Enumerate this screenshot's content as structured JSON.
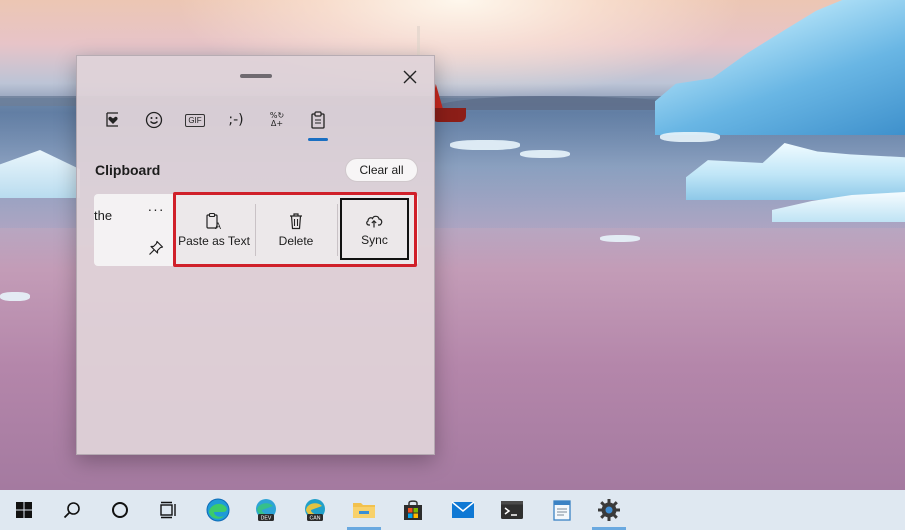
{
  "clipboard_panel": {
    "tabs": [
      {
        "name": "favorites",
        "icon": "heart-in-box-icon"
      },
      {
        "name": "emoji",
        "icon": "smiley-icon"
      },
      {
        "name": "gif",
        "icon": "gif-icon",
        "label": "GIF"
      },
      {
        "name": "kaomoji",
        "icon": "kaomoji-icon",
        "label": ";-)"
      },
      {
        "name": "symbols",
        "icon": "symbols-icon",
        "label": "%↻\nΔ+"
      },
      {
        "name": "clipboard",
        "icon": "clipboard-icon",
        "active": true
      }
    ],
    "section_title": "Clipboard",
    "clear_all_label": "Clear all",
    "item": {
      "text": "the",
      "more_label": "···"
    },
    "actions": [
      {
        "label": "Paste as Text",
        "icon": "paste-text-icon"
      },
      {
        "label": "Delete",
        "icon": "trash-icon"
      },
      {
        "label": "Sync",
        "icon": "cloud-upload-icon"
      }
    ]
  },
  "taskbar": {
    "items": [
      {
        "name": "start",
        "icon": "windows-logo-icon"
      },
      {
        "name": "search",
        "icon": "search-icon"
      },
      {
        "name": "cortana",
        "icon": "circle-icon"
      },
      {
        "name": "task-view",
        "icon": "task-view-icon"
      },
      {
        "name": "edge",
        "icon": "edge-icon"
      },
      {
        "name": "edge-dev",
        "icon": "edge-dev-icon",
        "badge": "DEV"
      },
      {
        "name": "edge-canary",
        "icon": "edge-canary-icon",
        "badge": "CAN"
      },
      {
        "name": "file-explorer",
        "icon": "folder-icon",
        "active": true
      },
      {
        "name": "store",
        "icon": "store-icon"
      },
      {
        "name": "mail",
        "icon": "mail-icon"
      },
      {
        "name": "terminal",
        "icon": "terminal-icon"
      },
      {
        "name": "notepad",
        "icon": "document-icon"
      },
      {
        "name": "settings",
        "icon": "gear-icon",
        "active": true
      }
    ]
  },
  "colors": {
    "highlight": "#d0202a",
    "accent": "#1a6fc2",
    "flyout_bg": "#e0d3d8",
    "taskbar_bg": "#dfe8f1"
  }
}
